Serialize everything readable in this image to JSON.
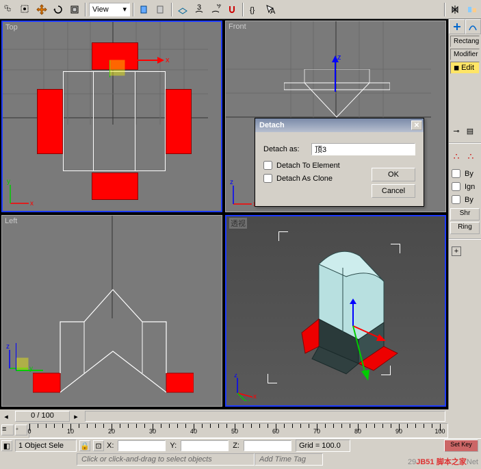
{
  "toolbar": {
    "view_dropdown": "View"
  },
  "viewports": {
    "top": {
      "label": "Top",
      "axes": [
        "x",
        "y"
      ]
    },
    "front": {
      "label": "Front",
      "axes": [
        "x",
        "z"
      ]
    },
    "left": {
      "label": "Left",
      "axes": [
        "y",
        "z"
      ]
    },
    "perspective": {
      "label": "透视",
      "axes": [
        "x",
        "y",
        "z"
      ]
    }
  },
  "dialog": {
    "title": "Detach",
    "detach_as_label": "Detach as:",
    "detach_as_value": "顶3",
    "chk_to_element": "Detach To Element",
    "chk_as_clone": "Detach As Clone",
    "ok": "OK",
    "cancel": "Cancel"
  },
  "right_panel": {
    "dropdown1": "Rectang",
    "dropdown2": "Modifier",
    "stack_item": "Edit",
    "chk_by1": "By",
    "chk_ign": "Ign",
    "chk_by2": "By",
    "btn_shrink": "Shr",
    "btn_ring": "Ring"
  },
  "time_slider": {
    "frame": "0 / 100"
  },
  "ruler": {
    "ticks": [
      0,
      10,
      20,
      30,
      40,
      50,
      60,
      70,
      80,
      90,
      100
    ]
  },
  "status": {
    "selection": "1 Object Sele",
    "x_label": "X:",
    "y_label": "Y:",
    "z_label": "Z:",
    "grid": "Grid = 100.0",
    "hint": "Click or click-and-drag to select objects",
    "add_tag": "Add Time Tag",
    "set_key": "Set Key"
  },
  "watermark": {
    "pre": "29",
    "site1": "JB51",
    "site2": "脚本之家",
    "net": "Net"
  }
}
